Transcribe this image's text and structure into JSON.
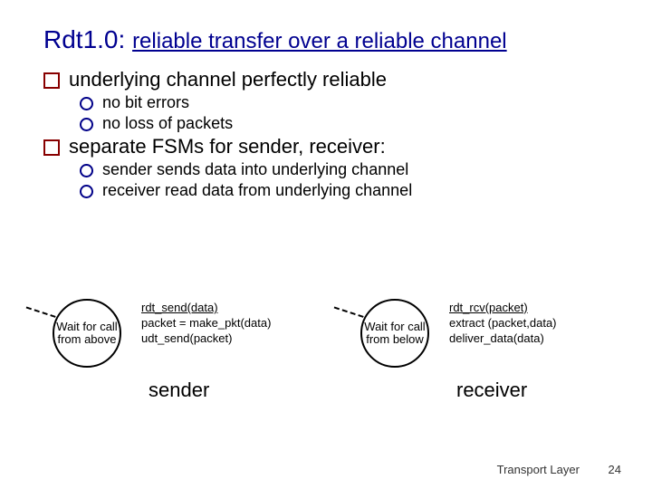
{
  "title": {
    "t1": "Rdt1.0:",
    "t2": "reliable transfer over a reliable channel"
  },
  "bullets": {
    "b1": "underlying channel perfectly reliable",
    "b1a": "no bit errors",
    "b1b": "no loss of packets",
    "b2": "separate FSMs for sender, receiver:",
    "b2a": "sender sends data into underlying channel",
    "b2b": "receiver read data from underlying channel"
  },
  "sender": {
    "state": "Wait for call from above",
    "event": "rdt_send(data)",
    "action1": "packet = make_pkt(data)",
    "action2": "udt_send(packet)",
    "label": "sender"
  },
  "receiver": {
    "state": "Wait for call from below",
    "event": "rdt_rcv(packet)",
    "action1": "extract (packet,data)",
    "action2": "deliver_data(data)",
    "label": "receiver"
  },
  "footer": {
    "section": "Transport Layer",
    "page": "24"
  }
}
